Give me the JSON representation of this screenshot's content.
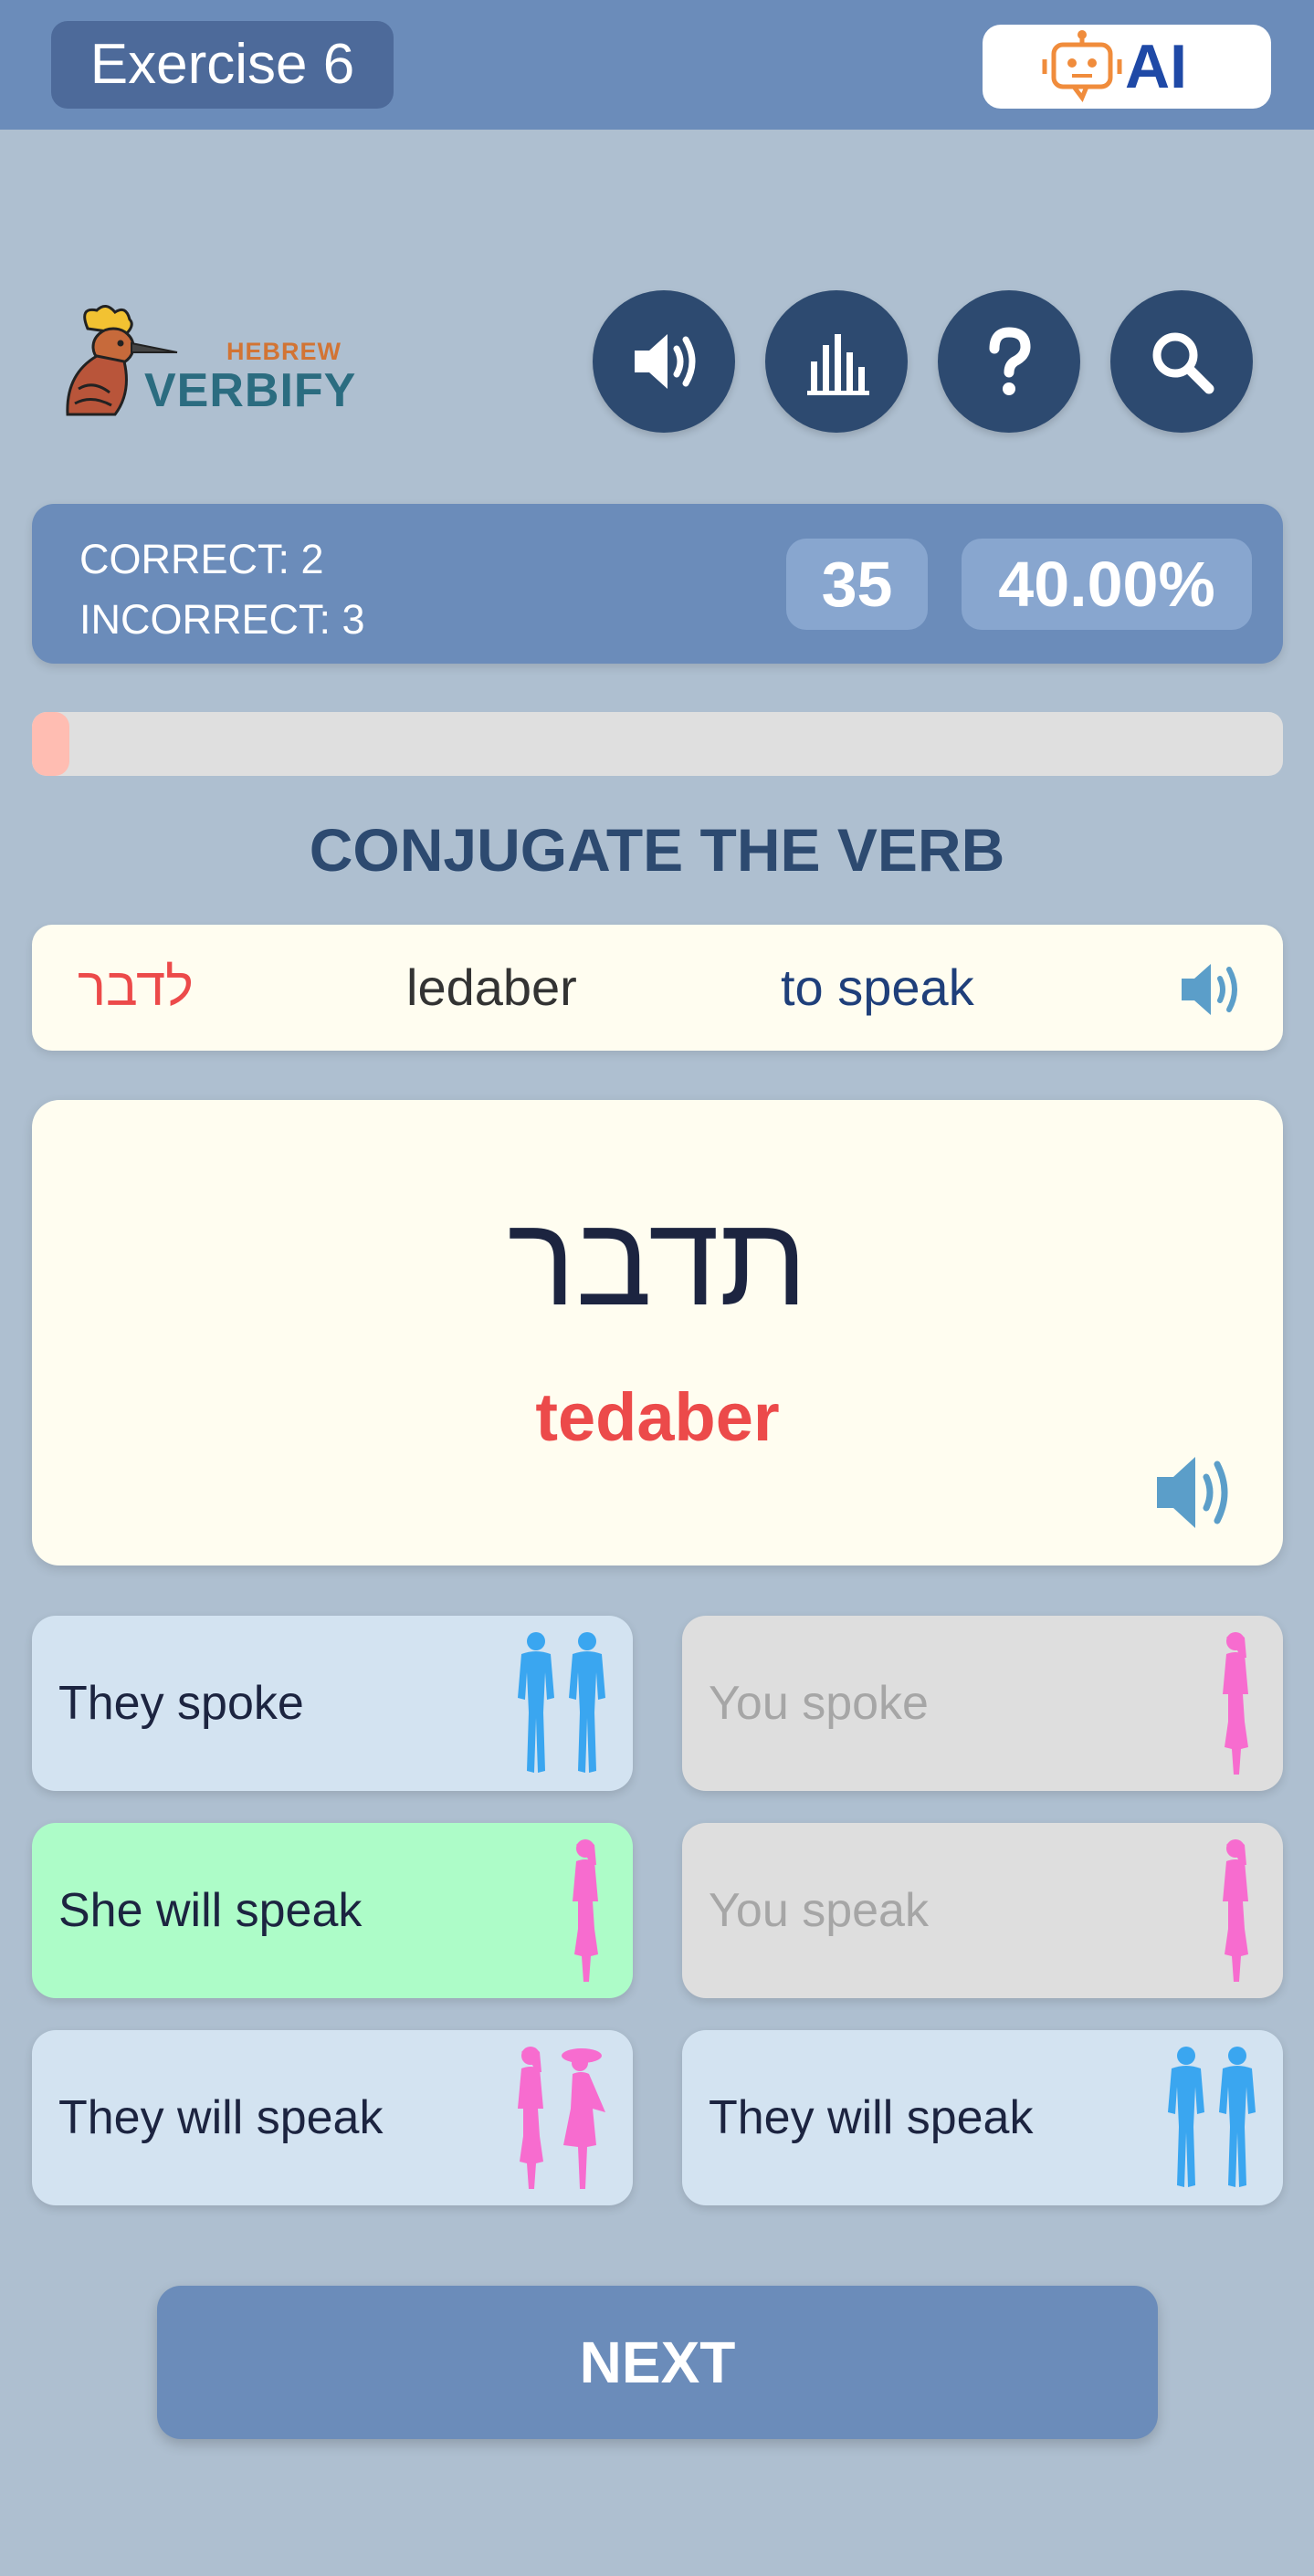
{
  "header": {
    "title": "Exercise 6",
    "ai_label": "AI"
  },
  "logo": {
    "small": "HEBREW",
    "big": "VERBIFY"
  },
  "toolbar": {
    "icons": [
      "speaker-icon",
      "bar-chart-icon",
      "question-icon",
      "search-icon"
    ]
  },
  "score": {
    "correct_label": "CORRECT: 2",
    "incorrect_label": "INCORRECT: 3",
    "count": "35",
    "percent": "40.00%"
  },
  "progress": {
    "fraction": 0.03,
    "color": "#ffbdb2"
  },
  "instruction": "CONJUGATE THE VERB",
  "verb": {
    "hebrew": "לדבר",
    "transliteration": "ledaber",
    "english": "to speak"
  },
  "card": {
    "hebrew": "תדבר",
    "transliteration": "tedaber"
  },
  "options": [
    {
      "label": "They spoke",
      "state": "default",
      "figure": "two-men"
    },
    {
      "label": "You spoke",
      "state": "disabled",
      "figure": "woman"
    },
    {
      "label": "She will speak",
      "state": "correct",
      "figure": "woman"
    },
    {
      "label": "You speak",
      "state": "disabled",
      "figure": "woman"
    },
    {
      "label": "They will speak",
      "state": "default",
      "figure": "two-women"
    },
    {
      "label": "They will speak",
      "state": "default",
      "figure": "two-men"
    }
  ],
  "next_label": "NEXT",
  "colors": {
    "background": "#aebfd0",
    "accent": "#6b8cba",
    "dark_button": "#2d4a70",
    "correct_green": "#adfcc8",
    "hebrew_red": "#ec4a4a"
  }
}
